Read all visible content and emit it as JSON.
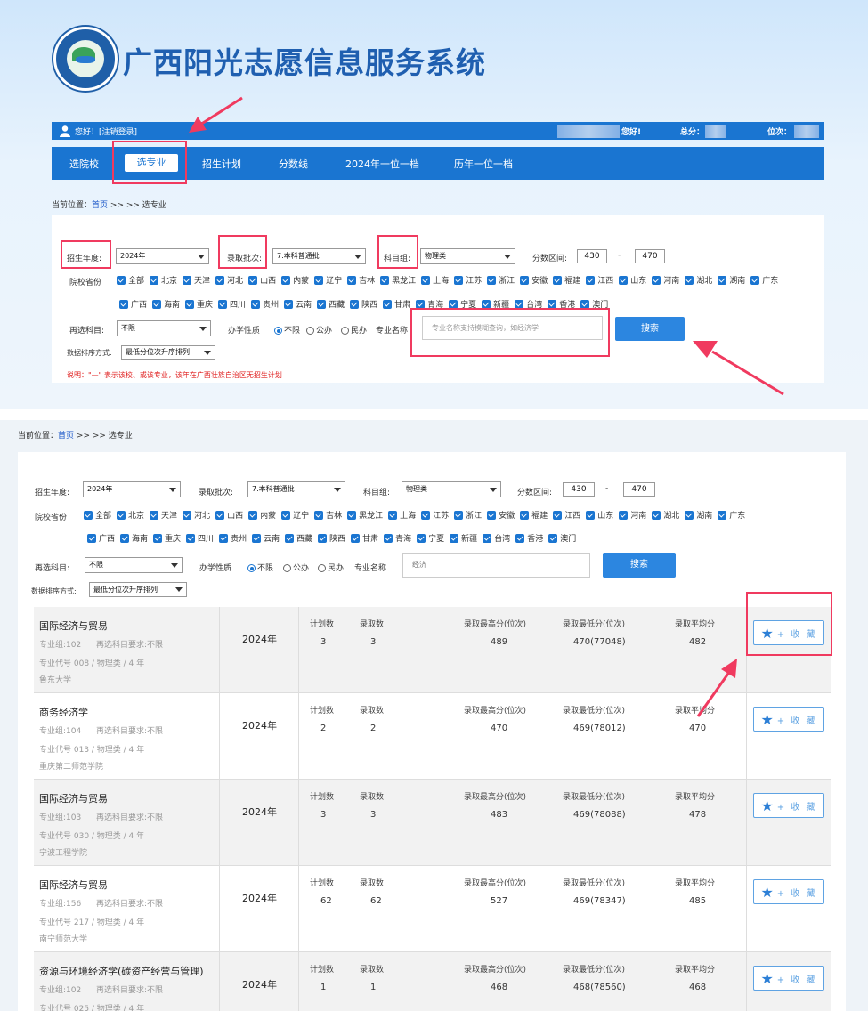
{
  "header": {
    "title": "广西阳光志愿信息服务系统"
  },
  "userbar": {
    "greeting": "您好！[注销登录]",
    "hello_suffix": "您好!",
    "total_label": "总分：",
    "rank_label": "位次："
  },
  "nav": {
    "items": [
      "选院校",
      "选专业",
      "招生计划",
      "分数线",
      "2024年一位一档",
      "历年一位一档"
    ],
    "active": "选专业"
  },
  "breadcrumb": {
    "prefix": "当前位置：",
    "home": "首页",
    "path": ">> >> 选专业"
  },
  "filters": {
    "year_label": "招生年度:",
    "year_value": "2024年",
    "batch_label": "录取批次:",
    "batch_value": "7.本科普通批",
    "subject_group_label": "科目组:",
    "subject_group_value": "物理类",
    "score_range_label": "分数区间:",
    "score_min": "430",
    "score_dash": "-",
    "score_max": "470",
    "province_label": "院校省份",
    "provinces_row1": [
      "全部",
      "北京",
      "天津",
      "河北",
      "山西",
      "内蒙",
      "辽宁",
      "吉林",
      "黑龙江",
      "上海",
      "江苏",
      "浙江",
      "安徽",
      "福建",
      "江西",
      "山东",
      "河南",
      "湖北",
      "湖南",
      "广东"
    ],
    "provinces_row2": [
      "广西",
      "海南",
      "重庆",
      "四川",
      "贵州",
      "云南",
      "西藏",
      "陕西",
      "甘肃",
      "青海",
      "宁夏",
      "新疆",
      "台湾",
      "香港",
      "澳门"
    ],
    "reselect_label": "再选科目:",
    "reselect_value": "不限",
    "ownership_label": "办学性质",
    "ownership_options": [
      "不限",
      "公办",
      "民办"
    ],
    "major_name_label": "专业名称",
    "major_search_placeholder": "专业名称支持模糊查询，如经济学",
    "major_search_value": "经济",
    "search_button": "搜索",
    "sort_label": "数据排序方式:",
    "sort_value": "最低分位次升序排列",
    "note": "说明：\"—\" 表示该校、或该专业，该年在广西壮族自治区无招生计划"
  },
  "result_headers": {
    "plan": "计划数",
    "admit": "录取数",
    "max": "录取最高分(位次)",
    "min": "录取最低分(位次)",
    "avg": "录取平均分",
    "fav_button": "+ 收 藏"
  },
  "results": [
    {
      "major": "国际经济与贸易",
      "group": "专业组:102",
      "requirement": "再选科目要求:不限",
      "code_line": "专业代号 008 / 物理类 / 4 年",
      "school": "鲁东大学",
      "year": "2024年",
      "plan": "3",
      "admit": "3",
      "max": "489",
      "min": "470(77048)",
      "avg": "482"
    },
    {
      "major": "商务经济学",
      "group": "专业组:104",
      "requirement": "再选科目要求:不限",
      "code_line": "专业代号 013 / 物理类 / 4 年",
      "school": "重庆第二师范学院",
      "year": "2024年",
      "plan": "2",
      "admit": "2",
      "max": "470",
      "min": "469(78012)",
      "avg": "470"
    },
    {
      "major": "国际经济与贸易",
      "group": "专业组:103",
      "requirement": "再选科目要求:不限",
      "code_line": "专业代号 030 / 物理类 / 4 年",
      "school": "宁波工程学院",
      "year": "2024年",
      "plan": "3",
      "admit": "3",
      "max": "483",
      "min": "469(78088)",
      "avg": "478"
    },
    {
      "major": "国际经济与贸易",
      "group": "专业组:156",
      "requirement": "再选科目要求:不限",
      "code_line": "专业代号 217 / 物理类 / 4 年",
      "school": "南宁师范大学",
      "year": "2024年",
      "plan": "62",
      "admit": "62",
      "max": "527",
      "min": "469(78347)",
      "avg": "485"
    },
    {
      "major": "资源与环境经济学(碳资产经营与管理)",
      "group": "专业组:102",
      "requirement": "再选科目要求:不限",
      "code_line": "专业代号 025 / 物理类 / 4 年",
      "school": "",
      "year": "2024年",
      "plan": "1",
      "admit": "1",
      "max": "468",
      "min": "468(78560)",
      "avg": "468"
    }
  ],
  "colors": {
    "primary": "#1a75d1",
    "highlight": "#f03a5f",
    "warning": "#e02020"
  }
}
